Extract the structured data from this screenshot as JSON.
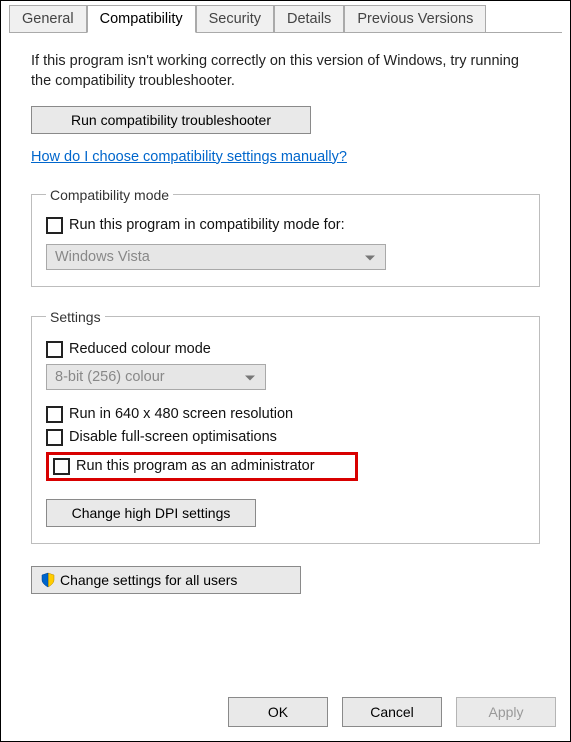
{
  "tabs": {
    "general": "General",
    "compatibility": "Compatibility",
    "security": "Security",
    "details": "Details",
    "previous_versions": "Previous Versions"
  },
  "intro_text": "If this program isn't working correctly on this version of Windows, try running the compatibility troubleshooter.",
  "troubleshooter_button": "Run compatibility troubleshooter",
  "manual_link": "How do I choose compatibility settings manually?",
  "compat_mode": {
    "legend": "Compatibility mode",
    "checkbox_label": "Run this program in compatibility mode for:",
    "dropdown_value": "Windows Vista"
  },
  "settings": {
    "legend": "Settings",
    "reduced_colour": "Reduced colour mode",
    "colour_dropdown": "8-bit (256) colour",
    "run640": "Run in 640 x 480 screen resolution",
    "disable_fs": "Disable full-screen optimisations",
    "run_admin": "Run this program as an administrator",
    "dpi_button": "Change high DPI settings"
  },
  "all_users_button": "Change settings for all users",
  "footer": {
    "ok": "OK",
    "cancel": "Cancel",
    "apply": "Apply"
  }
}
